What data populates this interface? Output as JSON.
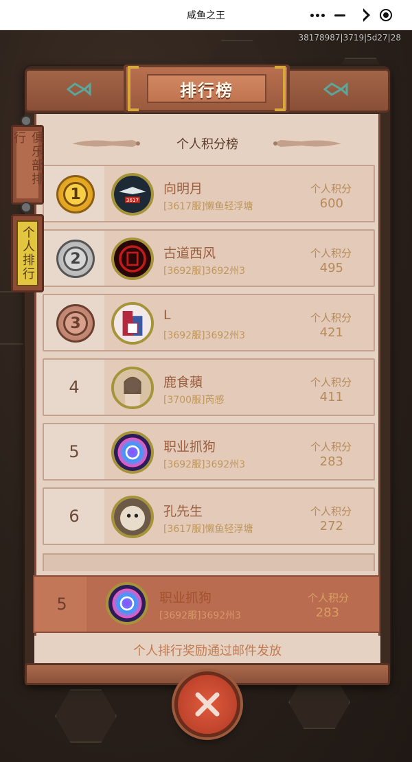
{
  "titlebar": {
    "title": "咸鱼之王"
  },
  "server_info": "38178987|3719|5d27|28",
  "board": {
    "title": "排行榜",
    "header": "个人积分榜",
    "footer_note": "个人排行奖励通过邮件发放"
  },
  "tabs": [
    {
      "label": "俱乐部排行",
      "selected": false
    },
    {
      "label": "个人排行",
      "selected": true
    }
  ],
  "score_label": "个人积分",
  "rows": [
    {
      "rank": "1",
      "medal": "gold",
      "name": "向明月",
      "server": "[3617服]懒鱼轻浮塘",
      "score": "600"
    },
    {
      "rank": "2",
      "medal": "silver",
      "name": "古道西风",
      "server": "[3692服]3692州3",
      "score": "495"
    },
    {
      "rank": "3",
      "medal": "bronze",
      "name": "L",
      "server": "[3692服]3692州3",
      "score": "421"
    },
    {
      "rank": "4",
      "medal": "",
      "name": "鹿食蘋",
      "server": "[3700服]芮感",
      "score": "411"
    },
    {
      "rank": "5",
      "medal": "",
      "name": "职业抓狗",
      "server": "[3692服]3692州3",
      "score": "283"
    },
    {
      "rank": "6",
      "medal": "",
      "name": "孔先生",
      "server": "[3617服]懒鱼轻浮塘",
      "score": "272"
    }
  ],
  "my_rank": {
    "rank": "5",
    "name": "职业抓狗",
    "server": "[3692服]3692州3",
    "score": "283"
  }
}
